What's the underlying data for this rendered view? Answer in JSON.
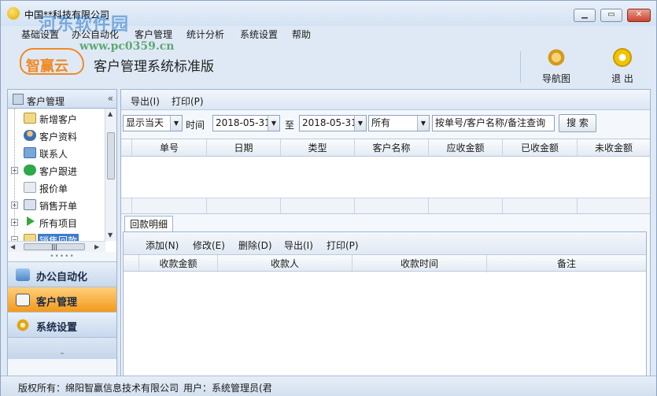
{
  "window": {
    "title": "中国**科技有限公司",
    "watermark": "河东软件园",
    "watermark_url": "www.pc0359.cn"
  },
  "menu": [
    "基础设置",
    "办公自动化",
    "客户管理",
    "统计分析",
    "系统设置",
    "帮助"
  ],
  "header": {
    "logo": "智赢云",
    "system_title": "客户管理系统标准版",
    "buttons": [
      {
        "label": "导航图",
        "icon": "gear-icon"
      },
      {
        "label": "退 出",
        "icon": "power-icon"
      }
    ]
  },
  "sidebar": {
    "title": "客户管理",
    "items": [
      {
        "label": "新增客户",
        "icon": "card-icon",
        "expandable": false
      },
      {
        "label": "客户资料",
        "icon": "person-icon",
        "expandable": false
      },
      {
        "label": "联系人",
        "icon": "contacts-icon",
        "expandable": false
      },
      {
        "label": "客户跟进",
        "icon": "check-icon",
        "expandable": true
      },
      {
        "label": "报价单",
        "icon": "document-icon",
        "expandable": false
      },
      {
        "label": "销售开单",
        "icon": "edit-icon",
        "expandable": true
      },
      {
        "label": "所有项目",
        "icon": "play-icon",
        "expandable": true
      },
      {
        "label": "销售回款",
        "icon": "card-icon",
        "expandable": true,
        "selected": true
      }
    ],
    "nav_groups": [
      {
        "label": "办公自动化",
        "active": false
      },
      {
        "label": "客户管理",
        "active": true
      },
      {
        "label": "系统设置",
        "active": false
      }
    ]
  },
  "toolbar": {
    "export": "导出(I)",
    "print": "打印(P)"
  },
  "filter": {
    "period": "显示当天",
    "time_label": "时间",
    "date_from": "2018-05-31",
    "to_label": "至",
    "date_to": "2018-05-31",
    "scope": "所有",
    "query": "按单号/客户名称/备注查询",
    "search_button": "搜 索"
  },
  "main_table": {
    "columns": [
      "单号",
      "日期",
      "类型",
      "客户名称",
      "应收金额",
      "已收金额",
      "未收金额"
    ],
    "rows": []
  },
  "detail": {
    "tab": "回款明细",
    "toolbar": [
      "添加(N)",
      "修改(E)",
      "删除(D)",
      "导出(I)",
      "打印(P)"
    ],
    "columns": [
      "收款金额",
      "收款人",
      "收款时间",
      "备注"
    ],
    "rows": []
  },
  "status": {
    "copyright": "版权所有：绵阳智赢信息技术有限公司",
    "user": "用户：系统管理员(君"
  },
  "colors": {
    "accent_orange": "#f29a1c",
    "selection_blue": "#3d7bd0",
    "frame_blue": "#dfe9f5"
  }
}
